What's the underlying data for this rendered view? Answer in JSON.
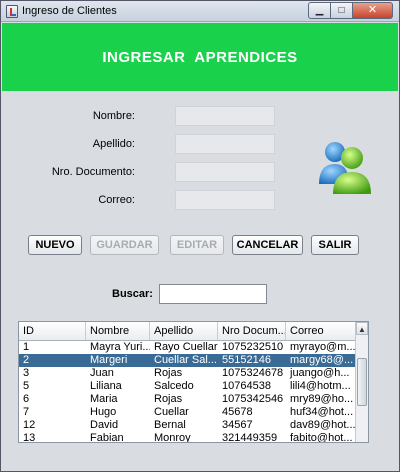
{
  "window": {
    "title": "Ingreso de Clientes",
    "min": "▁",
    "max": "□",
    "close": "✕"
  },
  "header": {
    "title": "INGRESAR  APRENDICES",
    "bg_color": "#19d14a"
  },
  "form": {
    "nombre_label": "Nombre:",
    "apellido_label": "Apellido:",
    "documento_label": "Nro. Documento:",
    "correo_label": "Correo:",
    "nombre_value": "",
    "apellido_value": "",
    "documento_value": "",
    "correo_value": ""
  },
  "buttons": {
    "nuevo": "NUEVO",
    "guardar": "GUARDAR",
    "editar": "EDITAR",
    "cancelar": "CANCELAR",
    "salir": "SALIR"
  },
  "search": {
    "label": "Buscar:",
    "value": ""
  },
  "table": {
    "columns": [
      "ID",
      "Nombre",
      "Apellido",
      "Nro Docum...",
      "Correo"
    ],
    "rows": [
      [
        "1",
        "Mayra Yuri...",
        "Rayo Cuellar",
        "1075232510",
        "myrayo@m..."
      ],
      [
        "2",
        "Margeri",
        "Cuellar Sal...",
        "55152146",
        "margy68@..."
      ],
      [
        "3",
        "Juan",
        "Rojas",
        "1075324678",
        "juango@h..."
      ],
      [
        "5",
        "Liliana",
        "Salcedo",
        "10764538",
        "lili4@hotm..."
      ],
      [
        "6",
        "Maria",
        "Rojas",
        "1075342546",
        "mry89@ho..."
      ],
      [
        "7",
        "Hugo",
        "Cuellar",
        "45678",
        "huf34@hot..."
      ],
      [
        "12",
        "David",
        "Bernal",
        "34567",
        "dav89@hot..."
      ],
      [
        "13",
        "Fabian",
        "Monroy",
        "321449359",
        "fabito@hot..."
      ]
    ],
    "selected_row": 1
  },
  "icons": {
    "app": "java-cup-icon",
    "users": "users-icon"
  },
  "colors": {
    "selected_row": "#3a6b96"
  }
}
